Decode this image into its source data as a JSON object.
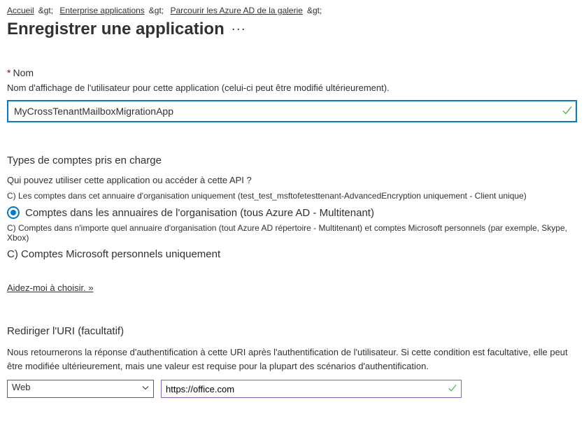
{
  "breadcrumb": {
    "items": [
      "Accueil",
      "Enterprise applications",
      "Parcourir les Azure AD de la galerie"
    ],
    "separator": "&gt;"
  },
  "page": {
    "title": "Enregistrer une application",
    "more": "···"
  },
  "name": {
    "label": "Nom",
    "required_marker": "*",
    "description": "Nom d'affichage de l'utilisateur pour cette application (celui-ci peut être modifié ultérieurement).",
    "value": "MyCrossTenantMailboxMigrationApp",
    "valid": true
  },
  "accountTypes": {
    "heading": "Types de comptes pris en charge",
    "question": "Qui pouvez utiliser cette application ou accéder à cette API ?",
    "opt1": "C) Les comptes dans cet annuaire d'organisation uniquement (test_test_msftofetesttenant-AdvancedEncryption uniquement - Client unique)",
    "opt2": "Comptes dans les annuaires de l'organisation (tous Azure AD - Multitenant)",
    "opt2_desc": "C) Comptes dans n'importe quel annuaire d'organisation (tout Azure AD répertoire - Multitenant) et comptes Microsoft personnels (par exemple, Skype, Xbox)",
    "opt3": "C) Comptes Microsoft personnels uniquement",
    "selected_index": 1,
    "help_link": "Aidez-moi à choisir. »"
  },
  "redirect": {
    "heading": "Rediriger l'URI (facultatif)",
    "description": "Nous retournerons la réponse d'authentification à cette URI après l'authentification de l'utilisateur. Si cette condition est facultative, elle peut être modifiée ultérieurement, mais une valeur est requise pour la plupart des scénarios d'authentification.",
    "platform": "Web",
    "uri": "https://office.com",
    "uri_valid": true
  },
  "colors": {
    "primary": "#0078d4",
    "success": "#5fb85f",
    "uri_border": "#8661c5"
  }
}
